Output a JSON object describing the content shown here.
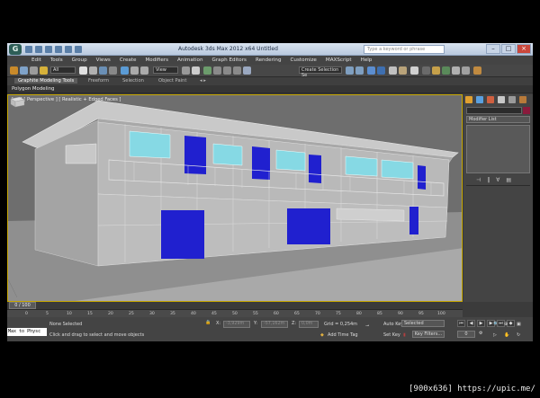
{
  "window": {
    "title": "Autodesk 3ds Max 2012 x64     Untitled",
    "search_placeholder": "Type a keyword or phrase",
    "app_logo": "G",
    "buttons": [
      "minimize",
      "maximize",
      "close"
    ]
  },
  "menu": [
    "Edit",
    "Tools",
    "Group",
    "Views",
    "Create",
    "Modifiers",
    "Animation",
    "Graph Editors",
    "Rendering",
    "Customize",
    "MAXScript",
    "Help"
  ],
  "toolbar": {
    "selection_filter": "All",
    "reference_coord": "View",
    "named_selection": "Create Selection Se"
  },
  "ribbon": {
    "tabs": [
      "Graphite Modeling Tools",
      "Freeform",
      "Selection",
      "Object Paint"
    ],
    "active_tab": "Graphite Modeling Tools",
    "panel_label": "Polygon Modeling"
  },
  "viewport": {
    "label": "[ + ] [ Perspective ] [ Realistic + Edged Faces ]"
  },
  "command_panel": {
    "modifier_list": "Modifier List",
    "color_swatch": "#8a1a3c",
    "stack_buttons": [
      "⊣",
      "‖",
      "∀",
      "▤"
    ]
  },
  "timeline": {
    "frame": "0 / 100",
    "ruler_ticks": [
      "0",
      "5",
      "10",
      "15",
      "20",
      "25",
      "30",
      "35",
      "40",
      "45",
      "50",
      "55",
      "60",
      "65",
      "70",
      "75",
      "80",
      "85",
      "90",
      "95",
      "100"
    ]
  },
  "status": {
    "maxscript": "Max to Physc",
    "selection": "None Selected",
    "prompt": "Click and drag to select and move objects",
    "x": "-3,929m",
    "y": "-57,162m",
    "z": "0,0m",
    "grid": "Grid = 0,254m",
    "add_time_tag": "Add Time Tag",
    "auto_key": "Auto Key",
    "selected": "Selected",
    "set_key": "Set Key",
    "key_filters": "Key Filters...",
    "current_frame": "0"
  },
  "watermark": "[900x636] https://upic.me/"
}
